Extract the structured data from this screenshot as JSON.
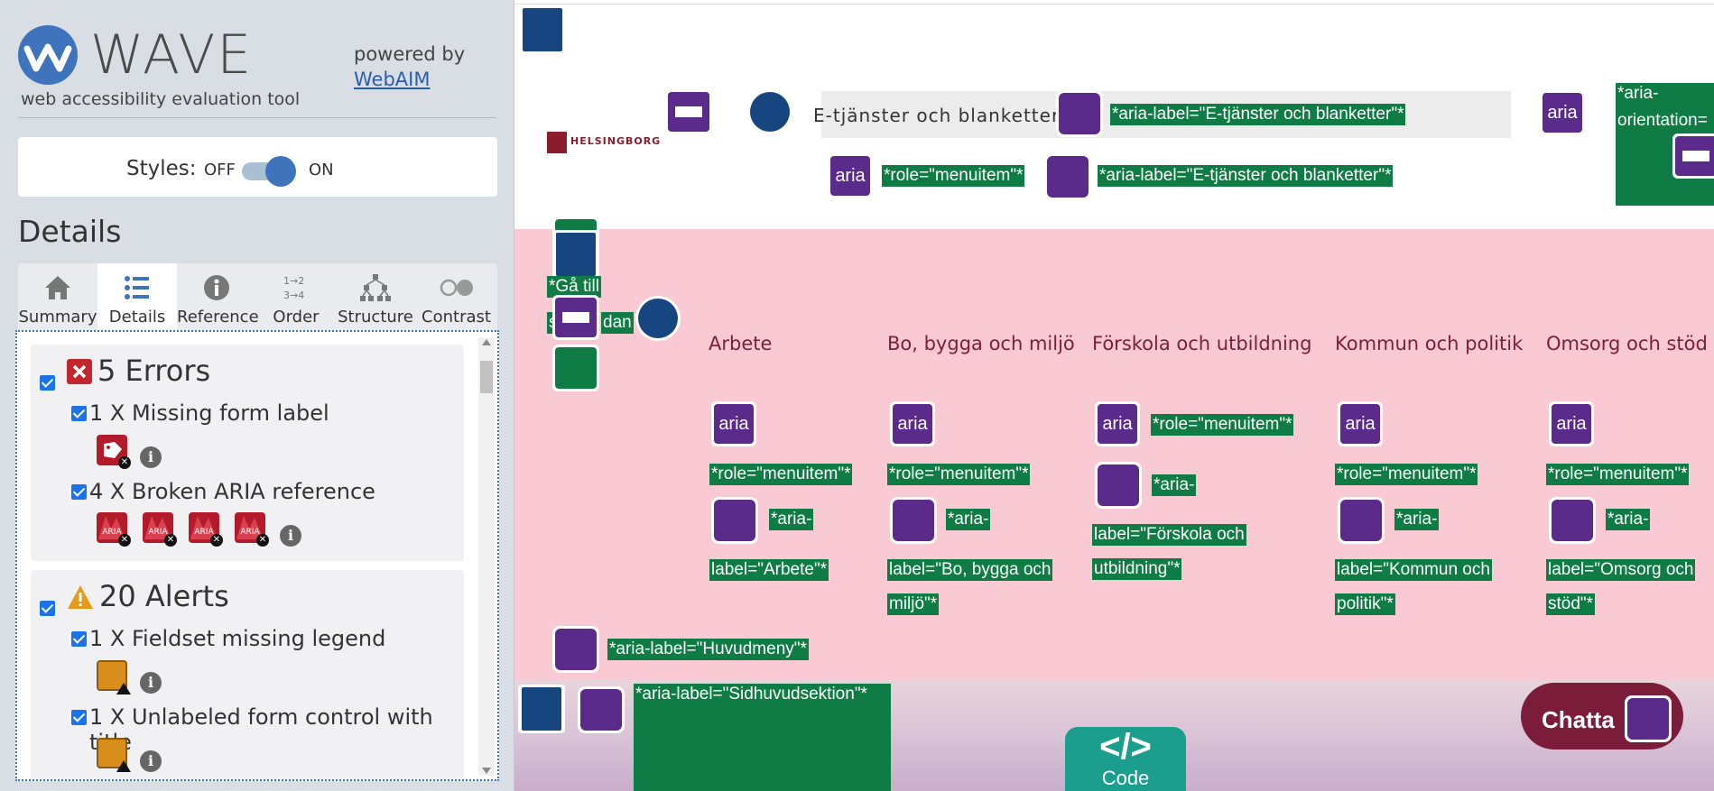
{
  "sidebar": {
    "logo_text": "WAVE",
    "tagline": "web accessibility evaluation tool",
    "powered_by": "powered by",
    "webaim_link": "WebAIM",
    "styles_label": "Styles:",
    "styles_off": "OFF",
    "styles_on": "ON",
    "details_heading": "Details",
    "tabs": [
      {
        "label": "Summary",
        "icon": "home-icon"
      },
      {
        "label": "Details",
        "icon": "list-icon"
      },
      {
        "label": "Reference",
        "icon": "info-icon"
      },
      {
        "label": "Order",
        "icon": "order-icon"
      },
      {
        "label": "Structure",
        "icon": "structure-icon"
      },
      {
        "label": "Contrast",
        "icon": "contrast-icon"
      }
    ],
    "active_tab": "Details",
    "errors": {
      "title": "5 Errors",
      "items": [
        {
          "label": "1 X Missing form label",
          "icon_count": 1
        },
        {
          "label": "4 X Broken ARIA reference",
          "icon_count": 4,
          "icon_text": "ARIA"
        }
      ]
    },
    "alerts": {
      "title": "20 Alerts",
      "items": [
        {
          "label": "1 X Fieldset missing legend"
        },
        {
          "label": "1 X Unlabeled form control with title"
        }
      ]
    }
  },
  "page": {
    "brand": "HELSINGBORG",
    "search_label": "E-tjänster och blanketter",
    "nav": [
      "Arbete",
      "Bo, bygga och miljö",
      "Förskola och utbildning",
      "Kommun och politik",
      "Omsorg och stöd"
    ],
    "annotations": {
      "header_aria_label": "*aria-label=\"E-tjänster och blanketter\"*",
      "header_role": "*role=\"menuitem\"*",
      "header_aria_label2": "*aria-label=\"E-tjänster och blanketter\"*",
      "aria_orientation_1": "*aria-",
      "aria_orientation_2": "orientation=",
      "skip_1": "*Gå till",
      "skip_2": "s",
      "skip_3": "dan",
      "role_menuitem": "*role=\"menuitem\"*",
      "nav_labels": [
        [
          "*aria-",
          "label=\"Arbete\"*"
        ],
        [
          "*aria-",
          "label=\"Bo, bygga och",
          "miljö\"*"
        ],
        [
          "*aria-",
          "label=\"Förskola och",
          "utbildning\"*"
        ],
        [
          "*aria-",
          "label=\"Kommun och",
          "politik\"*"
        ],
        [
          "*aria-",
          "label=\"Omsorg och",
          "stöd\"*"
        ]
      ],
      "huvudmeny": "*aria-label=\"Huvudmeny\"*",
      "sidhuvud": "*aria-label=\"Sidhuvudsektion\"*"
    },
    "aria_badge": "aria",
    "chat_button": "Chatta",
    "code_button_symbol": "</>",
    "code_button_label": "Code"
  },
  "colors": {
    "wave_blue": "#3f74bd",
    "error_red": "#b31b2b",
    "alert_orange": "#d98e1c",
    "aria_purple": "#5a2b8a",
    "annotation_green": "#107c45",
    "nav_pink_bg": "#f9c9d4",
    "nav_text": "#7e1e3a"
  }
}
